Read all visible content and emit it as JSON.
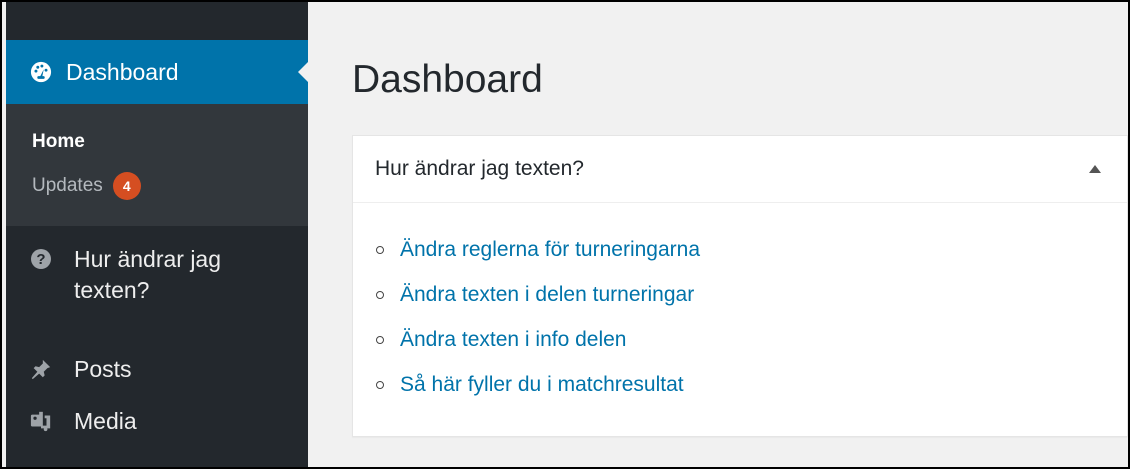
{
  "sidebar": {
    "current": {
      "label": "Dashboard",
      "icon": "dashboard-icon"
    },
    "submenu": [
      {
        "label": "Home",
        "current": true
      },
      {
        "label": "Updates",
        "badge": "4"
      }
    ],
    "items": [
      {
        "label": "Hur ändrar jag texten?",
        "icon": "help-icon"
      },
      {
        "label": "Posts",
        "icon": "pin-icon"
      },
      {
        "label": "Media",
        "icon": "media-icon"
      }
    ]
  },
  "main": {
    "title": "Dashboard",
    "widget": {
      "title": "Hur ändrar jag texten?",
      "links": [
        "Ändra reglerna för turneringarna",
        "Ändra texten i delen turneringar",
        "Ändra texten i info delen",
        "Så här fyller du i matchresultat"
      ]
    }
  },
  "colors": {
    "sidebar": "#23282d",
    "submenu": "#32373c",
    "accent": "#0073aa",
    "badge": "#d54e21",
    "background": "#f1f1f1"
  }
}
